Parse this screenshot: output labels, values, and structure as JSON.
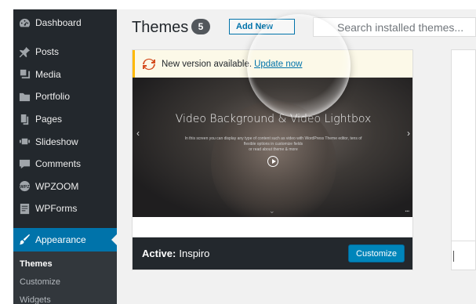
{
  "sidebar": {
    "items": [
      {
        "label": "Dashboard",
        "icon": "dashboard-icon"
      },
      {
        "label": "Posts",
        "icon": "pin-icon"
      },
      {
        "label": "Media",
        "icon": "media-icon"
      },
      {
        "label": "Portfolio",
        "icon": "folder-icon"
      },
      {
        "label": "Pages",
        "icon": "pages-icon"
      },
      {
        "label": "Slideshow",
        "icon": "slideshow-icon"
      },
      {
        "label": "Comments",
        "icon": "comment-icon"
      },
      {
        "label": "WPZOOM",
        "icon": "wpzoom-icon"
      },
      {
        "label": "WPForms",
        "icon": "forms-icon"
      }
    ],
    "active": {
      "label": "Appearance",
      "icon": "brush-icon"
    },
    "submenu": [
      "Themes",
      "Customize",
      "Widgets"
    ]
  },
  "header": {
    "title": "Themes",
    "count": "5",
    "add_new_label": "Add New",
    "search_placeholder": "Search installed themes..."
  },
  "theme": {
    "notice_text": "New version available.",
    "notice_link": "Update now",
    "preview_title": "Video Background & Video Lightbox",
    "preview_subtitle": "In this screen you can display any type of content such as video with WordPress Theme editor, tens of flexible options in customize fields",
    "preview_cta": "or read about theme & more",
    "active_prefix": "Active:",
    "active_name": "Inspiro",
    "customize_label": "Customize"
  },
  "colors": {
    "sidebar_bg": "#23282d",
    "accent": "#0073aa",
    "button": "#0085ba",
    "notice_border": "#ffb900"
  }
}
